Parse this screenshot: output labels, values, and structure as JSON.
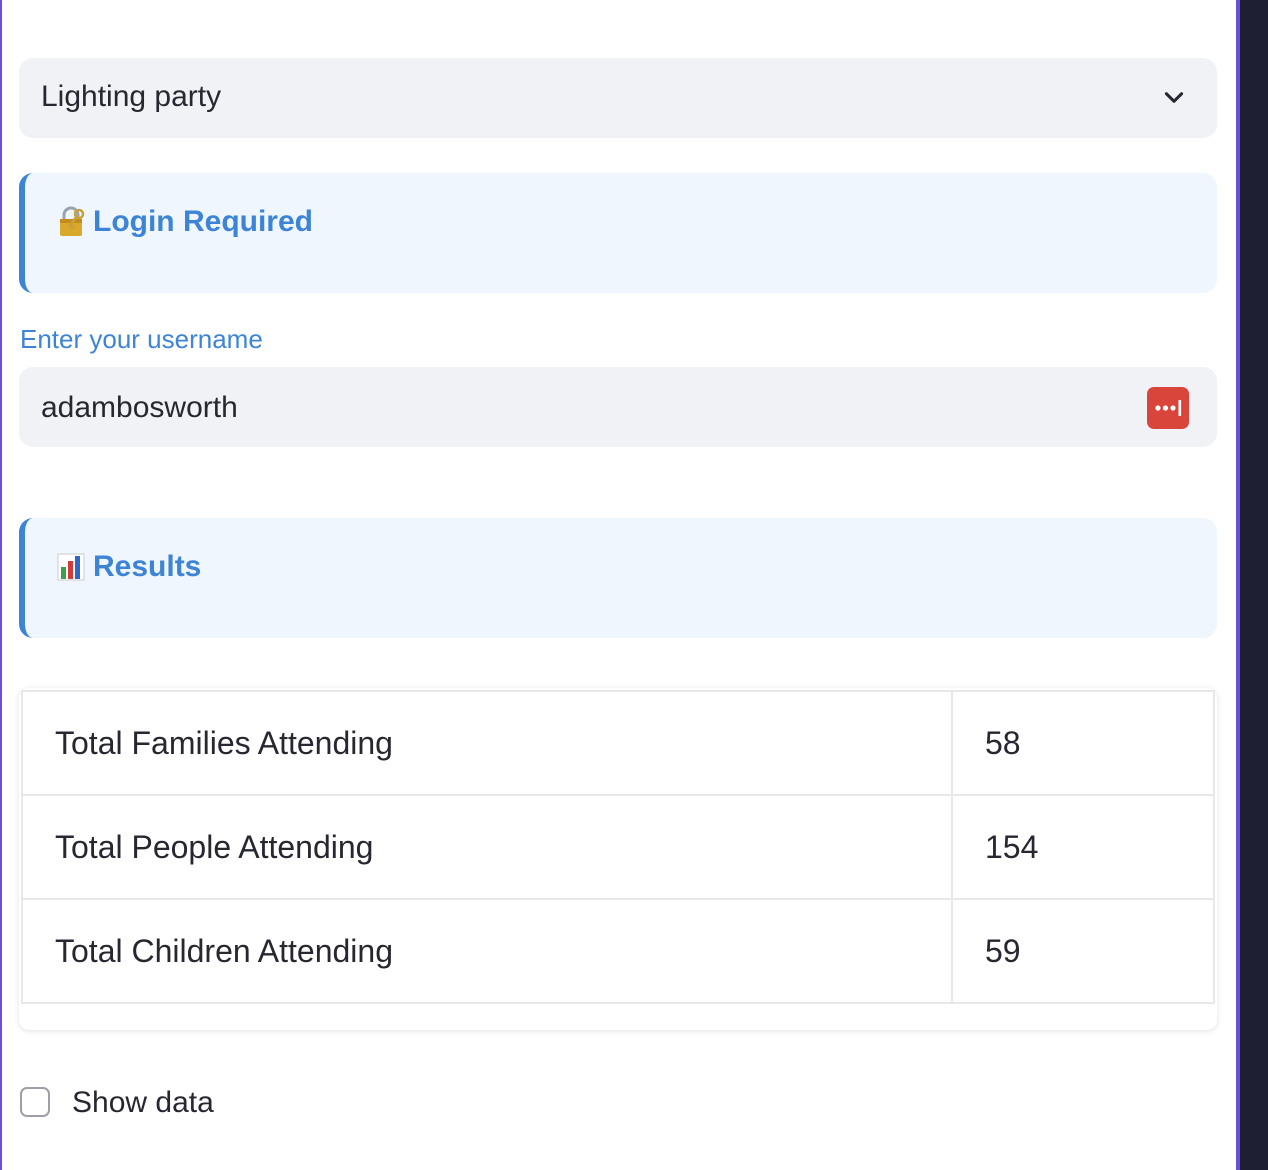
{
  "select": {
    "value": "Lighting party",
    "icon": "chevron-down-icon"
  },
  "login_callout": {
    "icon": "locked-with-key-icon",
    "title": "Login Required"
  },
  "username": {
    "label": "Enter your username",
    "value": "adambosworth",
    "icon": "password-manager-icon"
  },
  "results_callout": {
    "icon": "bar-chart-icon",
    "title": "Results"
  },
  "results_table": {
    "rows": [
      {
        "label": "Total Families Attending",
        "value": "58"
      },
      {
        "label": "Total People Attending",
        "value": "154"
      },
      {
        "label": "Total Children Attending",
        "value": "59"
      }
    ]
  },
  "show_data": {
    "label": "Show data",
    "checked": false
  },
  "colors": {
    "accent": "#3d84d6",
    "callout_bg": "#eff6fd",
    "input_bg": "#f0f2f6",
    "frame": "#6a4fd8",
    "password_icon": "#d9443b"
  }
}
